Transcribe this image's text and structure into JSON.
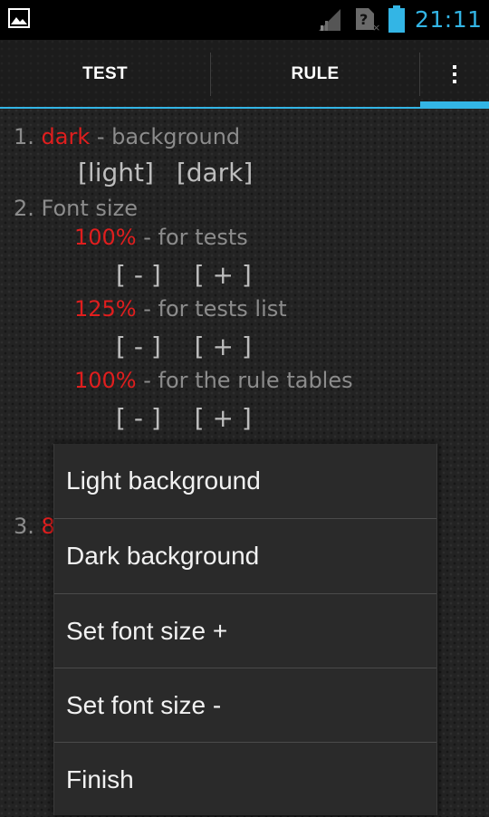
{
  "status_bar": {
    "time": "21:11",
    "icons": [
      "picture-icon",
      "signal-icon",
      "no-sim-icon",
      "battery-icon"
    ],
    "accent_color": "#33b5e5"
  },
  "tabs": [
    {
      "label": "TEST"
    },
    {
      "label": "RULE"
    }
  ],
  "overflow_icon": "overflow-menu-icon",
  "settings": {
    "item1": {
      "number": "1.",
      "value": "dark",
      "text": " - background",
      "buttons": [
        "[light]",
        "[dark]"
      ]
    },
    "item2": {
      "number": "2.",
      "text": " Font size",
      "rows": [
        {
          "value": "100%",
          "text": " - for tests",
          "minus": "[ - ]",
          "plus": "[ + ]"
        },
        {
          "value": "125%",
          "text": " - for tests list",
          "minus": "[ - ]",
          "plus": "[ + ]"
        },
        {
          "value": "100%",
          "text": " - for the rule tables",
          "minus": "[ - ]",
          "plus": "[ + ]"
        }
      ]
    },
    "item3": {
      "number": "3.",
      "value_partial": "8"
    }
  },
  "menu": {
    "items": [
      {
        "label": "Light background"
      },
      {
        "label": "Dark background"
      },
      {
        "label": "Set font size +"
      },
      {
        "label": "Set font size -"
      },
      {
        "label": "Finish"
      }
    ]
  },
  "colors": {
    "accent": "#33b5e5",
    "value_red": "#e01e1e",
    "text_gray": "#8c8c8c"
  }
}
